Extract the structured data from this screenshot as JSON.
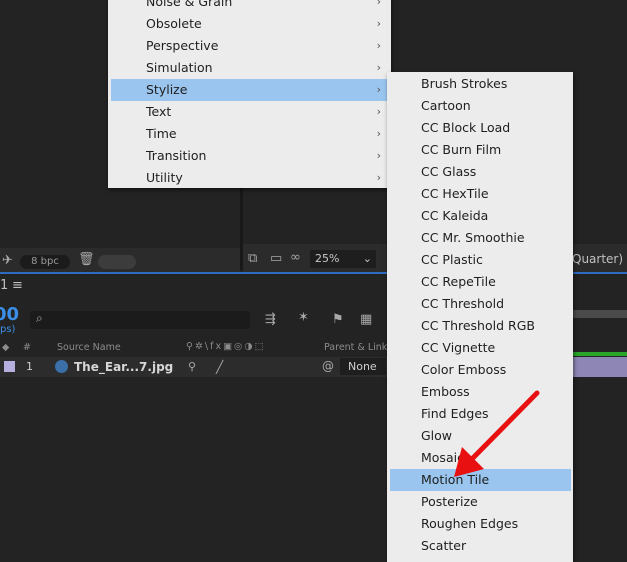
{
  "left_menu": {
    "items": [
      {
        "label": "Noise & Grain",
        "submenu": true
      },
      {
        "label": "Obsolete",
        "submenu": true
      },
      {
        "label": "Perspective",
        "submenu": true
      },
      {
        "label": "Simulation",
        "submenu": true
      },
      {
        "label": "Stylize",
        "submenu": true,
        "selected": true
      },
      {
        "label": "Text",
        "submenu": true
      },
      {
        "label": "Time",
        "submenu": true
      },
      {
        "label": "Transition",
        "submenu": true
      },
      {
        "label": "Utility",
        "submenu": true
      }
    ],
    "chevron": "›"
  },
  "submenu": {
    "items": [
      "Brush Strokes",
      "Cartoon",
      "CC Block Load",
      "CC Burn Film",
      "CC Glass",
      "CC HexTile",
      "CC Kaleida",
      "CC Mr. Smoothie",
      "CC Plastic",
      "CC RepeTile",
      "CC Threshold",
      "CC Threshold RGB",
      "CC Vignette",
      "Color Emboss",
      "Emboss",
      "Find Edges",
      "Glow",
      "Mosaic",
      "Motion Tile",
      "Posterize",
      "Roughen Edges",
      "Scatter"
    ],
    "selected": "Motion Tile"
  },
  "viewer": {
    "bpc": "8 bpc",
    "zoom": "25%",
    "resolution": "Quarter)"
  },
  "timeline": {
    "time_big": "00",
    "fps": "ps)",
    "panel_num": "1",
    "columns": {
      "hash": "#",
      "source_name": "Source Name",
      "parent_link": "Parent & Link"
    },
    "layer": {
      "index": "1",
      "name": "The_Ear...7.jpg",
      "parent": "None"
    }
  },
  "colors": {
    "menu_bg": "#ececec",
    "highlight": "#99c5ee",
    "accent_blue": "#2d6cc0",
    "arrow_red": "#e81010"
  }
}
